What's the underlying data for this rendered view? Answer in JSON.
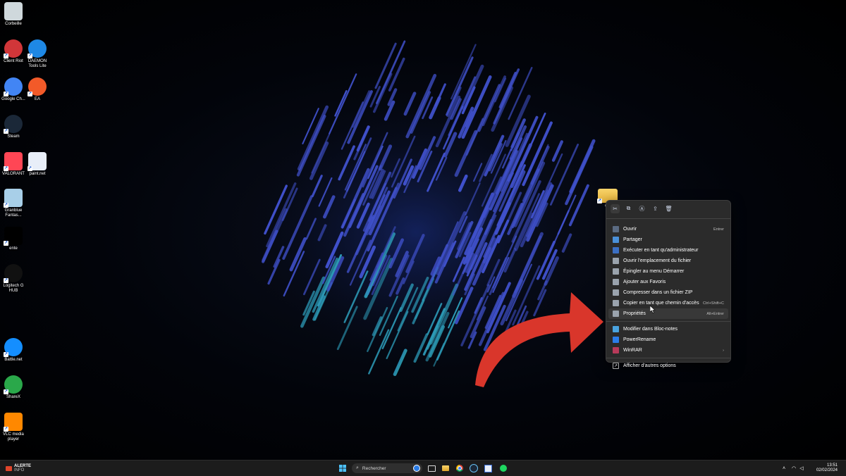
{
  "desktop_icons": [
    {
      "label": "Corbeille",
      "icon": "recycle-bin-icon",
      "color": "#cfd8dc"
    },
    {
      "label": "Client Riot",
      "icon": "riot-client-icon",
      "color": "#d13639"
    },
    {
      "label": "DAEMON Tools Lite",
      "icon": "daemon-tools-icon",
      "color": "#1e88e5"
    },
    {
      "label": "Google Ch...",
      "icon": "chrome-icon",
      "color": "#4285f4"
    },
    {
      "label": "EA",
      "icon": "ea-icon",
      "color": "#f25a29"
    },
    {
      "label": "Steam",
      "icon": "steam-icon",
      "color": "#1b2838"
    },
    {
      "label": "VALORANT",
      "icon": "valorant-icon",
      "color": "#ff4655"
    },
    {
      "label": "paint.net",
      "icon": "paintnet-icon",
      "color": "#e8eef8"
    },
    {
      "label": "Granblue Fantas...",
      "icon": "granblue-icon",
      "color": "#a8cfe8"
    },
    {
      "label": "ente",
      "icon": "ente-icon",
      "color": "#000000"
    },
    {
      "label": "Logitech G HUB",
      "icon": "logitech-icon",
      "color": "#111111"
    },
    {
      "label": "Battle.net",
      "icon": "battlenet-icon",
      "color": "#148eff"
    },
    {
      "label": "ShareX",
      "icon": "sharex-icon",
      "color": "#2aa84a"
    },
    {
      "label": "VLC media player",
      "icon": "vlc-icon",
      "color": "#ff8800"
    }
  ],
  "selected_folder": {
    "label": "Co",
    "icon": "folder-icon"
  },
  "context_menu": {
    "toolbar": [
      {
        "name": "cut-icon",
        "glyph": "✂"
      },
      {
        "name": "copy-icon",
        "glyph": "⧉"
      },
      {
        "name": "rename-icon",
        "glyph": "Ⓐ"
      },
      {
        "name": "share-icon",
        "glyph": "⇪"
      },
      {
        "name": "delete-icon",
        "glyph": "🗑"
      }
    ],
    "items": [
      {
        "label": "Ouvrir",
        "shortcut": "Entrer",
        "icon": "open-icon",
        "icon_color": "#5b6b82"
      },
      {
        "label": "Partager",
        "shortcut": "",
        "icon": "share-icon",
        "icon_color": "#4a90d9"
      },
      {
        "label": "Exécuter en tant qu'administrateur",
        "shortcut": "",
        "icon": "admin-shield-icon",
        "icon_color": "#3b6fc4"
      },
      {
        "label": "Ouvrir l'emplacement du fichier",
        "shortcut": "",
        "icon": "folder-open-icon",
        "icon_color": "#9aa3ad"
      },
      {
        "label": "Épingler au menu Démarrer",
        "shortcut": "",
        "icon": "pin-icon",
        "icon_color": "#9aa3ad"
      },
      {
        "label": "Ajouter aux Favoris",
        "shortcut": "",
        "icon": "star-icon",
        "icon_color": "#9aa3ad"
      },
      {
        "label": "Compresser dans un fichier ZIP",
        "shortcut": "",
        "icon": "zip-icon",
        "icon_color": "#9aa3ad"
      },
      {
        "label": "Copier en tant que chemin d'accès",
        "shortcut": "Ctrl+Shift+C",
        "icon": "copy-path-icon",
        "icon_color": "#9aa3ad"
      },
      {
        "label": "Propriétés",
        "shortcut": "Alt+Entrer",
        "icon": "properties-wrench-icon",
        "icon_color": "#9aa3ad"
      }
    ],
    "extra_items": [
      {
        "label": "Modifier dans Bloc-notes",
        "shortcut": "",
        "icon": "notepad-icon",
        "icon_color": "#4aa3df"
      },
      {
        "label": "PowerRename",
        "shortcut": "",
        "icon": "powerrename-icon",
        "icon_color": "#2b7de9"
      },
      {
        "label": "WinRAR",
        "shortcut": "›",
        "icon": "winrar-icon",
        "icon_color": "#b83a5a"
      }
    ],
    "more_options": {
      "label": "Afficher d'autres options",
      "icon": "more-options-icon"
    }
  },
  "taskbar": {
    "alert_title": "ALERTE",
    "alert_sub": "INFO",
    "search_placeholder": "Rechercher",
    "time": "13:51",
    "date": "02/02/2024",
    "accent": "#e0452b"
  },
  "annotation": {
    "arrow_color": "#d9362b"
  }
}
